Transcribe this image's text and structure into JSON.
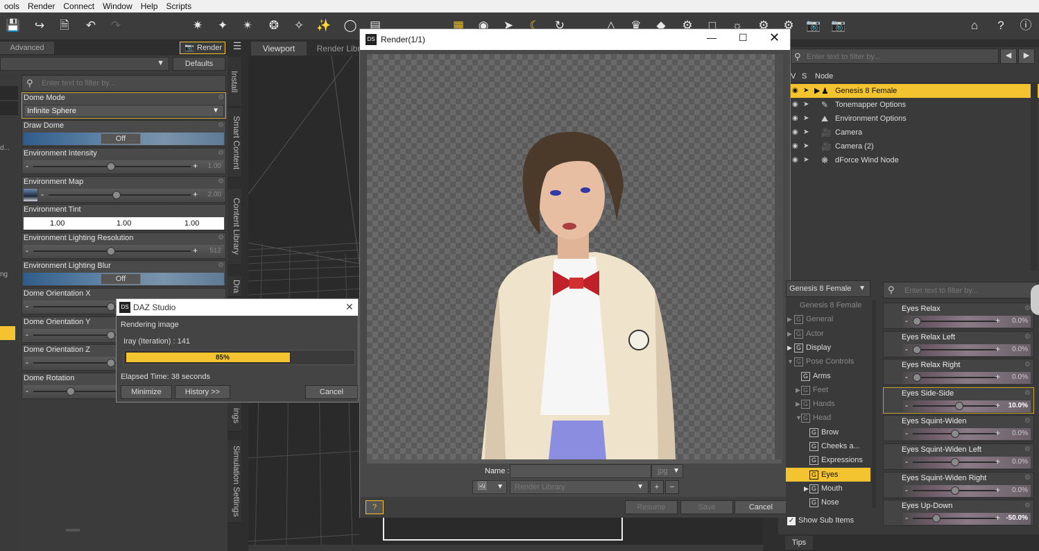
{
  "menubar": [
    "ools",
    "Render",
    "Connect",
    "Window",
    "Help",
    "Scripts"
  ],
  "left_panel": {
    "tab_advanced": "Advanced",
    "tab_render": "Render",
    "defaults_button": "Defaults",
    "filter_placeholder": "Enter text to filter by...",
    "edge_fragments": [
      "d...",
      "ng"
    ],
    "properties": {
      "dome_mode": {
        "label": "Dome Mode",
        "value": "Infinite Sphere"
      },
      "draw_dome": {
        "label": "Draw Dome",
        "value": "Off"
      },
      "env_intensity": {
        "label": "Environment Intensity",
        "value": "1.00"
      },
      "env_map": {
        "label": "Environment Map",
        "value": "2.00"
      },
      "env_tint": {
        "label": "Environment Tint",
        "r": "1.00",
        "g": "1.00",
        "b": "1.00"
      },
      "env_light_res": {
        "label": "Environment Lighting Resolution",
        "value": "512"
      },
      "env_light_blur": {
        "label": "Environment Lighting Blur",
        "value": "Off"
      },
      "dome_orient_x": {
        "label": "Dome Orientation X"
      },
      "dome_orient_y": {
        "label": "Dome Orientation Y"
      },
      "dome_orient_z": {
        "label": "Dome Orientation Z"
      },
      "dome_rotation": {
        "label": "Dome Rotation"
      }
    }
  },
  "side_tabs": [
    "Install",
    "Smart Content",
    "Content Library",
    "Dra",
    "ings",
    "Simulation Settings"
  ],
  "viewport_tabs": {
    "viewport": "Viewport",
    "render_library": "Render Libr"
  },
  "render_window": {
    "title": "Render(1/1)",
    "name_label": "Name :",
    "format": "jpg",
    "library_placeholder": "Render Library",
    "resume": "Resume",
    "save": "Save",
    "cancel": "Cancel",
    "help": "?"
  },
  "progress_dialog": {
    "title": "DAZ Studio",
    "status": "Rendering image",
    "iteration": "Iray (Iteration) : 141",
    "percent_label": "85%",
    "progress": 0.85,
    "elapsed": "Elapsed Time:  38 seconds",
    "minimize": "Minimize",
    "history": "History >>",
    "cancel": "Cancel"
  },
  "scene": {
    "filter_placeholder": "Enter text to filter by...",
    "col_v": "V",
    "col_s": "S",
    "col_node": "Node",
    "nodes": [
      {
        "name": "Genesis 8 Female",
        "icon": "figure-icon"
      },
      {
        "name": "Tonemapper Options",
        "icon": "tonemapper-icon"
      },
      {
        "name": "Environment Options",
        "icon": "environment-icon"
      },
      {
        "name": "Camera",
        "icon": "camera-icon"
      },
      {
        "name": "Camera (2)",
        "icon": "camera-icon"
      },
      {
        "name": "dForce Wind Node",
        "icon": "wind-icon"
      }
    ]
  },
  "parameters": {
    "figure_select": "Genesis 8 Female",
    "filter_placeholder": "Enter text to filter by...",
    "tree": [
      {
        "label": "Genesis 8 Female",
        "dim": true,
        "level": 0
      },
      {
        "label": "General",
        "dim": true,
        "level": 1
      },
      {
        "label": "Actor",
        "dim": true,
        "level": 1
      },
      {
        "label": "Display",
        "dim": false,
        "level": 1
      },
      {
        "label": "Pose Controls",
        "dim": true,
        "level": 1
      },
      {
        "label": "Arms",
        "dim": false,
        "level": 2
      },
      {
        "label": "Feet",
        "dim": true,
        "level": 2
      },
      {
        "label": "Hands",
        "dim": true,
        "level": 2
      },
      {
        "label": "Head",
        "dim": true,
        "level": 2
      },
      {
        "label": "Brow",
        "dim": false,
        "level": 3
      },
      {
        "label": "Cheeks a...",
        "dim": false,
        "level": 3
      },
      {
        "label": "Expressions",
        "dim": false,
        "level": 3
      },
      {
        "label": "Eyes",
        "dim": false,
        "level": 3,
        "selected": true
      },
      {
        "label": "Mouth",
        "dim": false,
        "level": 3
      },
      {
        "label": "Nose",
        "dim": false,
        "level": 3
      }
    ],
    "show_sub_items": "Show Sub Items",
    "sliders": [
      {
        "label": "Eyes Relax",
        "value": "0.0%",
        "pos": 0.0
      },
      {
        "label": "Eyes Relax Left",
        "value": "0.0%",
        "pos": 0.0
      },
      {
        "label": "Eyes Relax Right",
        "value": "0.0%",
        "pos": 0.0
      },
      {
        "label": "Eyes Side-Side",
        "value": "10.0%",
        "pos": 0.55
      },
      {
        "label": "Eyes Squint-Widen",
        "value": "0.0%",
        "pos": 0.5
      },
      {
        "label": "Eyes Squint-Widen Left",
        "value": "0.0%",
        "pos": 0.5
      },
      {
        "label": "Eyes Squint-Widen Right",
        "value": "0.0%",
        "pos": 0.5
      },
      {
        "label": "Eyes Up-Down",
        "value": "-50.0%",
        "pos": 0.25
      }
    ]
  },
  "tips_tab": "Tips",
  "colors": {
    "accent": "#f4c430",
    "panel": "#3b3b3b",
    "dark": "#2a2a2a"
  }
}
